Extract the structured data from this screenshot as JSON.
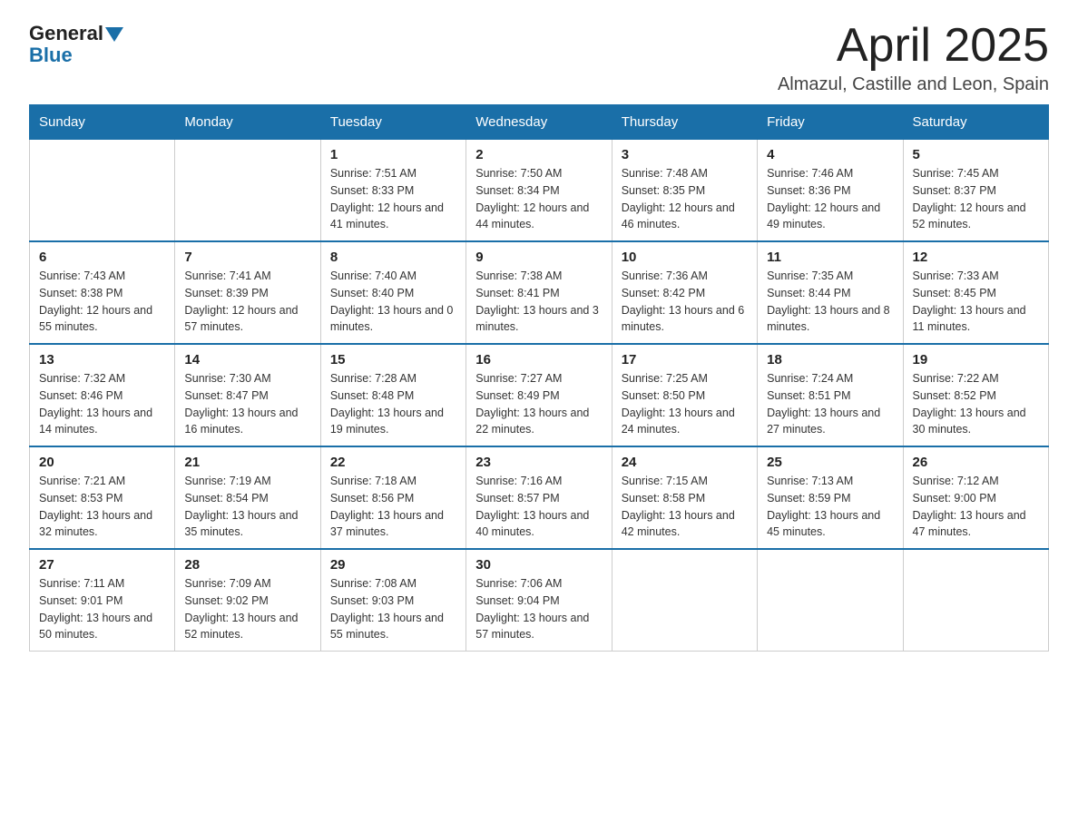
{
  "header": {
    "logo_general": "General",
    "logo_blue": "Blue",
    "month_title": "April 2025",
    "subtitle": "Almazul, Castille and Leon, Spain"
  },
  "weekdays": [
    "Sunday",
    "Monday",
    "Tuesday",
    "Wednesday",
    "Thursday",
    "Friday",
    "Saturday"
  ],
  "weeks": [
    [
      {
        "day": "",
        "sunrise": "",
        "sunset": "",
        "daylight": ""
      },
      {
        "day": "",
        "sunrise": "",
        "sunset": "",
        "daylight": ""
      },
      {
        "day": "1",
        "sunrise": "Sunrise: 7:51 AM",
        "sunset": "Sunset: 8:33 PM",
        "daylight": "Daylight: 12 hours and 41 minutes."
      },
      {
        "day": "2",
        "sunrise": "Sunrise: 7:50 AM",
        "sunset": "Sunset: 8:34 PM",
        "daylight": "Daylight: 12 hours and 44 minutes."
      },
      {
        "day": "3",
        "sunrise": "Sunrise: 7:48 AM",
        "sunset": "Sunset: 8:35 PM",
        "daylight": "Daylight: 12 hours and 46 minutes."
      },
      {
        "day": "4",
        "sunrise": "Sunrise: 7:46 AM",
        "sunset": "Sunset: 8:36 PM",
        "daylight": "Daylight: 12 hours and 49 minutes."
      },
      {
        "day": "5",
        "sunrise": "Sunrise: 7:45 AM",
        "sunset": "Sunset: 8:37 PM",
        "daylight": "Daylight: 12 hours and 52 minutes."
      }
    ],
    [
      {
        "day": "6",
        "sunrise": "Sunrise: 7:43 AM",
        "sunset": "Sunset: 8:38 PM",
        "daylight": "Daylight: 12 hours and 55 minutes."
      },
      {
        "day": "7",
        "sunrise": "Sunrise: 7:41 AM",
        "sunset": "Sunset: 8:39 PM",
        "daylight": "Daylight: 12 hours and 57 minutes."
      },
      {
        "day": "8",
        "sunrise": "Sunrise: 7:40 AM",
        "sunset": "Sunset: 8:40 PM",
        "daylight": "Daylight: 13 hours and 0 minutes."
      },
      {
        "day": "9",
        "sunrise": "Sunrise: 7:38 AM",
        "sunset": "Sunset: 8:41 PM",
        "daylight": "Daylight: 13 hours and 3 minutes."
      },
      {
        "day": "10",
        "sunrise": "Sunrise: 7:36 AM",
        "sunset": "Sunset: 8:42 PM",
        "daylight": "Daylight: 13 hours and 6 minutes."
      },
      {
        "day": "11",
        "sunrise": "Sunrise: 7:35 AM",
        "sunset": "Sunset: 8:44 PM",
        "daylight": "Daylight: 13 hours and 8 minutes."
      },
      {
        "day": "12",
        "sunrise": "Sunrise: 7:33 AM",
        "sunset": "Sunset: 8:45 PM",
        "daylight": "Daylight: 13 hours and 11 minutes."
      }
    ],
    [
      {
        "day": "13",
        "sunrise": "Sunrise: 7:32 AM",
        "sunset": "Sunset: 8:46 PM",
        "daylight": "Daylight: 13 hours and 14 minutes."
      },
      {
        "day": "14",
        "sunrise": "Sunrise: 7:30 AM",
        "sunset": "Sunset: 8:47 PM",
        "daylight": "Daylight: 13 hours and 16 minutes."
      },
      {
        "day": "15",
        "sunrise": "Sunrise: 7:28 AM",
        "sunset": "Sunset: 8:48 PM",
        "daylight": "Daylight: 13 hours and 19 minutes."
      },
      {
        "day": "16",
        "sunrise": "Sunrise: 7:27 AM",
        "sunset": "Sunset: 8:49 PM",
        "daylight": "Daylight: 13 hours and 22 minutes."
      },
      {
        "day": "17",
        "sunrise": "Sunrise: 7:25 AM",
        "sunset": "Sunset: 8:50 PM",
        "daylight": "Daylight: 13 hours and 24 minutes."
      },
      {
        "day": "18",
        "sunrise": "Sunrise: 7:24 AM",
        "sunset": "Sunset: 8:51 PM",
        "daylight": "Daylight: 13 hours and 27 minutes."
      },
      {
        "day": "19",
        "sunrise": "Sunrise: 7:22 AM",
        "sunset": "Sunset: 8:52 PM",
        "daylight": "Daylight: 13 hours and 30 minutes."
      }
    ],
    [
      {
        "day": "20",
        "sunrise": "Sunrise: 7:21 AM",
        "sunset": "Sunset: 8:53 PM",
        "daylight": "Daylight: 13 hours and 32 minutes."
      },
      {
        "day": "21",
        "sunrise": "Sunrise: 7:19 AM",
        "sunset": "Sunset: 8:54 PM",
        "daylight": "Daylight: 13 hours and 35 minutes."
      },
      {
        "day": "22",
        "sunrise": "Sunrise: 7:18 AM",
        "sunset": "Sunset: 8:56 PM",
        "daylight": "Daylight: 13 hours and 37 minutes."
      },
      {
        "day": "23",
        "sunrise": "Sunrise: 7:16 AM",
        "sunset": "Sunset: 8:57 PM",
        "daylight": "Daylight: 13 hours and 40 minutes."
      },
      {
        "day": "24",
        "sunrise": "Sunrise: 7:15 AM",
        "sunset": "Sunset: 8:58 PM",
        "daylight": "Daylight: 13 hours and 42 minutes."
      },
      {
        "day": "25",
        "sunrise": "Sunrise: 7:13 AM",
        "sunset": "Sunset: 8:59 PM",
        "daylight": "Daylight: 13 hours and 45 minutes."
      },
      {
        "day": "26",
        "sunrise": "Sunrise: 7:12 AM",
        "sunset": "Sunset: 9:00 PM",
        "daylight": "Daylight: 13 hours and 47 minutes."
      }
    ],
    [
      {
        "day": "27",
        "sunrise": "Sunrise: 7:11 AM",
        "sunset": "Sunset: 9:01 PM",
        "daylight": "Daylight: 13 hours and 50 minutes."
      },
      {
        "day": "28",
        "sunrise": "Sunrise: 7:09 AM",
        "sunset": "Sunset: 9:02 PM",
        "daylight": "Daylight: 13 hours and 52 minutes."
      },
      {
        "day": "29",
        "sunrise": "Sunrise: 7:08 AM",
        "sunset": "Sunset: 9:03 PM",
        "daylight": "Daylight: 13 hours and 55 minutes."
      },
      {
        "day": "30",
        "sunrise": "Sunrise: 7:06 AM",
        "sunset": "Sunset: 9:04 PM",
        "daylight": "Daylight: 13 hours and 57 minutes."
      },
      {
        "day": "",
        "sunrise": "",
        "sunset": "",
        "daylight": ""
      },
      {
        "day": "",
        "sunrise": "",
        "sunset": "",
        "daylight": ""
      },
      {
        "day": "",
        "sunrise": "",
        "sunset": "",
        "daylight": ""
      }
    ]
  ]
}
